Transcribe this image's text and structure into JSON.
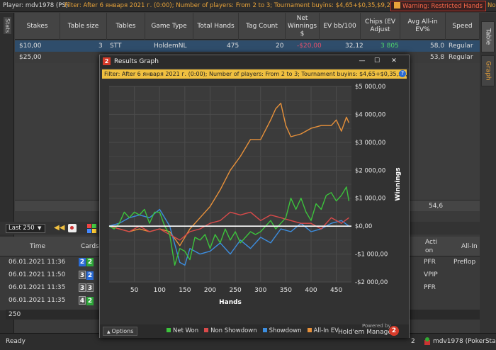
{
  "topbar": {
    "player": "Player: mdv1978 (PS)",
    "filter": "Filter: After 6 января 2021 г. (0:00); Number of players: From 2 to 3; Tournament buyins: $4,65+$0,35,$9,20+$0,80,$23,50+$1,50",
    "warning": "Warning: Restricted Hands",
    "right_cut": "No"
  },
  "left_tab": "Stats",
  "right_tabs": [
    "Table",
    "Graph"
  ],
  "columns": [
    "Stakes",
    "Table size",
    "Tables",
    "Game Type",
    "Total Hands",
    "Tag Count",
    "Net Winnings $",
    "EV bb/100",
    "Chips (EV Adjust",
    "Avg All-in EV%",
    "Speed"
  ],
  "rows": [
    {
      "stakes": "$10,00",
      "table_size": "3",
      "tables": "STT",
      "game_type": "HoldemNL",
      "total_hands": "475",
      "tag_count": "20",
      "net_winnings": "-$20,00",
      "ev_bb100": "32,12",
      "chips": "3 805",
      "avg_allin": "58,0",
      "speed": "Regular"
    },
    {
      "stakes": "$25,00",
      "table_size": "",
      "tables": "",
      "game_type": "",
      "total_hands": "",
      "tag_count": "",
      "net_winnings": "",
      "ev_bb100": "",
      "chips": "",
      "avg_allin": "53,8",
      "speed": "Regular"
    }
  ],
  "summary_value": "54,6",
  "filter_select": "Last 250",
  "hands_columns": {
    "time": "Time",
    "cards": "Cards",
    "action": "Acti on",
    "allin": "All-In"
  },
  "hand_rows": [
    {
      "time": "06.01.2021 11:36",
      "cards": [
        "2",
        "2"
      ],
      "action": "PFR",
      "allin": "Preflop"
    },
    {
      "time": "06.01.2021 11:50",
      "cards": [
        "3",
        "2"
      ],
      "action": "VPIP",
      "allin": ""
    },
    {
      "time": "06.01.2021 11:35",
      "cards": [
        "3",
        "3"
      ],
      "action": "PFR",
      "allin": ""
    },
    {
      "time": "06.01.2021 11:35",
      "cards": [
        "4",
        "2"
      ],
      "action": "PFR",
      "allin": ""
    }
  ],
  "input_value": "250",
  "status": {
    "ready": "Ready",
    "count": "2",
    "user": "mdv1978 (PokerStars)"
  },
  "dialog": {
    "title": "Results Graph",
    "filter": "Filter: After 6 января 2021 г. (0:00); Number of players: From 2 to 3; Tournament buyins: $4,65+$0,35,$9,20+$0,80,$23,5",
    "options": "Options",
    "powered": "Powered by",
    "brand": "Hold'em Manager",
    "brand_num": "2"
  },
  "colors": {
    "net_won": "#3cc33c",
    "non_showdown": "#d94a4a",
    "showdown": "#3c8ee0",
    "allin_ev": "#e8913a",
    "accent": "#e8a33a"
  },
  "chart_data": {
    "type": "line",
    "xlabel": "Hands",
    "ylabel": "Winnings",
    "xlim": [
      0,
      480
    ],
    "ylim": [
      -2000,
      5000
    ],
    "xticks": [
      50,
      100,
      150,
      200,
      250,
      300,
      350,
      400,
      450
    ],
    "yticks": [
      5000,
      4000,
      3000,
      2000,
      1000,
      0,
      -1000,
      -2000
    ],
    "ytick_labels": [
      "$5 000,00",
      "$4 000,00",
      "$3 000,00",
      "$2 000,00",
      "$1 000,00",
      "$0,00",
      "-$1 000,00",
      "-$2 000,00"
    ],
    "series": [
      {
        "name": "Net Won",
        "color": "#3cc33c",
        "x": [
          0,
          10,
          20,
          30,
          40,
          50,
          60,
          70,
          80,
          90,
          100,
          110,
          120,
          130,
          140,
          150,
          160,
          170,
          180,
          190,
          200,
          210,
          220,
          230,
          240,
          250,
          260,
          270,
          280,
          290,
          300,
          310,
          320,
          330,
          340,
          350,
          360,
          370,
          380,
          390,
          400,
          410,
          420,
          430,
          440,
          450,
          460,
          470,
          475
        ],
        "y": [
          0,
          -100,
          100,
          500,
          300,
          500,
          400,
          600,
          100,
          500,
          500,
          0,
          -300,
          -1400,
          -800,
          -900,
          -1200,
          -400,
          -500,
          -300,
          -800,
          -300,
          -600,
          -100,
          -500,
          -200,
          -600,
          -400,
          -200,
          -300,
          -200,
          0,
          200,
          -100,
          100,
          300,
          1000,
          600,
          1000,
          500,
          200,
          800,
          600,
          1100,
          1200,
          900,
          1100,
          1400,
          900
        ]
      },
      {
        "name": "Non Showdown",
        "color": "#d94a4a",
        "x": [
          0,
          20,
          40,
          60,
          80,
          100,
          120,
          140,
          160,
          180,
          200,
          220,
          240,
          260,
          280,
          300,
          320,
          340,
          360,
          380,
          400,
          420,
          440,
          460,
          475
        ],
        "y": [
          0,
          -100,
          -200,
          0,
          -200,
          -100,
          -300,
          -500,
          -200,
          -100,
          100,
          200,
          500,
          400,
          500,
          200,
          400,
          300,
          200,
          100,
          100,
          -100,
          300,
          100,
          300
        ]
      },
      {
        "name": "Showdown",
        "color": "#3c8ee0",
        "x": [
          0,
          20,
          40,
          60,
          80,
          100,
          120,
          140,
          150,
          160,
          180,
          200,
          220,
          240,
          260,
          280,
          300,
          320,
          340,
          360,
          380,
          400,
          420,
          440,
          460,
          475
        ],
        "y": [
          0,
          100,
          300,
          400,
          300,
          600,
          0,
          -1300,
          -1400,
          -800,
          -1000,
          -900,
          -600,
          -1000,
          -500,
          -800,
          -400,
          -600,
          -100,
          -200,
          100,
          -200,
          -100,
          100,
          200,
          0
        ]
      },
      {
        "name": "All-In EV",
        "color": "#e8913a",
        "x": [
          0,
          20,
          40,
          60,
          80,
          100,
          120,
          140,
          160,
          180,
          200,
          220,
          240,
          260,
          280,
          300,
          320,
          330,
          340,
          350,
          360,
          380,
          400,
          420,
          440,
          450,
          460,
          470,
          475
        ],
        "y": [
          0,
          -100,
          -200,
          -100,
          -200,
          -100,
          -200,
          -700,
          -100,
          300,
          700,
          1300,
          2000,
          2500,
          3100,
          3100,
          3800,
          4200,
          4400,
          3600,
          3200,
          3300,
          3500,
          3600,
          3600,
          3800,
          3400,
          3900,
          3700
        ]
      }
    ]
  }
}
